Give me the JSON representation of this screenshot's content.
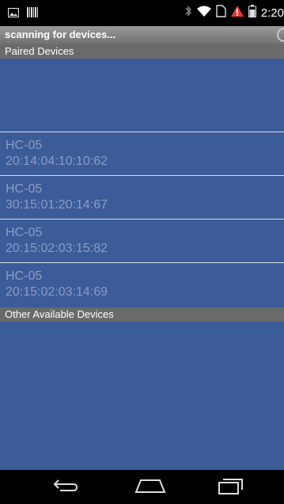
{
  "status_bar": {
    "time": "2:20"
  },
  "header": {
    "title": "scanning for devices..."
  },
  "paired": {
    "header": "Paired Devices",
    "devices": [
      {
        "name": "HC-05",
        "address": "20:14:04:10:10:62"
      },
      {
        "name": "HC-05",
        "address": "30:15:01:20:14:67"
      },
      {
        "name": "HC-05",
        "address": "20:15:02:03:15:82"
      },
      {
        "name": "HC-05",
        "address": "20:15:02:03:14:69"
      }
    ]
  },
  "other": {
    "header": "Other Available Devices"
  },
  "colors": {
    "list_bg": "#3b5b99",
    "text": "#8e9dc4",
    "header_bg": "#6a6a6a"
  }
}
